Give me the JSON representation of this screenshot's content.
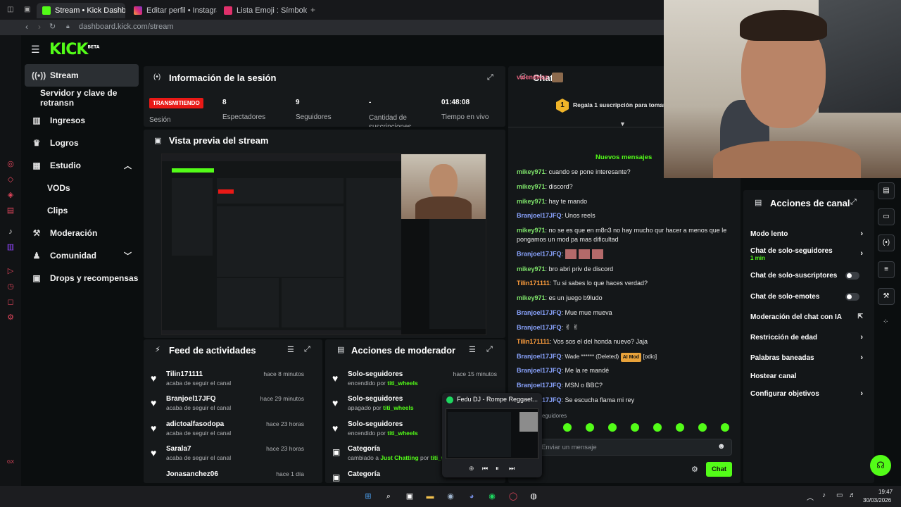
{
  "browser": {
    "tabs": [
      {
        "label": "Stream • Kick Dashboard",
        "active": true
      },
      {
        "label": "Editar perfil • Instagram",
        "active": false
      },
      {
        "label": "Lista Emoji : Símbolos em",
        "active": false
      }
    ],
    "url": "dashboard.kick.com/stream"
  },
  "brand": {
    "logo": "KICK",
    "beta": "BETA"
  },
  "nav": {
    "items": [
      {
        "label": "Stream",
        "icon": "broadcast-icon",
        "active": true
      },
      {
        "label": "Servidor y clave de retransn",
        "icon": "",
        "active": false
      },
      {
        "label": "Ingresos",
        "icon": "bar-chart-icon",
        "active": false
      },
      {
        "label": "Logros",
        "icon": "trophy-icon",
        "active": false
      },
      {
        "label": "Estudio",
        "icon": "grid-icon",
        "active": false
      },
      {
        "label": "VODs",
        "icon": "",
        "active": false
      },
      {
        "label": "Clips",
        "icon": "",
        "active": false
      },
      {
        "label": "Moderación",
        "icon": "wrench-icon",
        "active": false
      },
      {
        "label": "Comunidad",
        "icon": "community-icon",
        "active": false
      },
      {
        "label": "Drops y recompensas",
        "icon": "gift-icon",
        "active": false
      }
    ]
  },
  "session": {
    "title": "Información de la sesión",
    "badge": "TRANSMITIENDO",
    "badge_label": "Sesión",
    "stats": [
      {
        "value": "8",
        "label": "Espectadores"
      },
      {
        "value": "9",
        "label": "Seguidores"
      },
      {
        "value": "-",
        "label": "Cantidad de suscripciones"
      },
      {
        "value": "01:48:08",
        "label": "Tiempo en vivo"
      }
    ]
  },
  "preview": {
    "title": "Vista previa del stream"
  },
  "feed": {
    "title": "Feed de actividades",
    "rows": [
      {
        "name": "Tilin171111",
        "sub": "acaba de seguir el canal",
        "time": "hace 8 minutos"
      },
      {
        "name": "Branjoel17JFQ",
        "sub": "acaba de seguir el canal",
        "time": "hace 29 minutos"
      },
      {
        "name": "adictoalfasodopa",
        "sub": "acaba de seguir el canal",
        "time": "hace 23 horas"
      },
      {
        "name": "Sarala7",
        "sub": "acaba de seguir el canal",
        "time": "hace 23 horas"
      },
      {
        "name": "Jonasanchez06",
        "sub": "",
        "time": "hace 1 día"
      }
    ]
  },
  "modactions": {
    "title": "Acciones de moderador",
    "rows": [
      {
        "name": "Solo-seguidores",
        "sub_a": "encendido por",
        "who": "titi_wheels",
        "time": "hace 15 minutos"
      },
      {
        "name": "Solo-seguidores",
        "sub_a": "apagado por",
        "who": "titi_wheels",
        "time": ""
      },
      {
        "name": "Solo-seguidores",
        "sub_a": "encendido por",
        "who": "titi_wheels",
        "time": ""
      },
      {
        "name": "Categoría",
        "sub_a": "cambiado a",
        "who": "Just Chatting",
        "sub_b": "por",
        "who2": "titi_w",
        "time": ""
      },
      {
        "name": "Categoría",
        "sub_a": "",
        "who": "",
        "time": ""
      }
    ]
  },
  "chat": {
    "title": "Chat",
    "gift": "Regala 1 suscripción para tomar la",
    "new_messages": "Nuevos mensajes",
    "lines": [
      {
        "user": "valendwzz",
        "text": "",
        "color": "#e8637f"
      },
      {
        "user": "mikey971",
        "text": "cuando se pone interesante?",
        "color": "#7ee36a"
      },
      {
        "user": "mikey971",
        "text": "discord?",
        "color": "#7ee36a"
      },
      {
        "user": "mikey971",
        "text": "hay te mando",
        "color": "#7ee36a"
      },
      {
        "user": "Branjoel17JFQ",
        "text": "Unos reels",
        "color": "#8aa4ff"
      },
      {
        "user": "mikey971",
        "text": "no se es que en m8n3 no hay mucho qur hacer a menos que le pongamos un mod pa mas dificultad",
        "color": "#7ee36a"
      },
      {
        "user": "Branjoel17JFQ",
        "text": "",
        "color": "#8aa4ff"
      },
      {
        "user": "mikey971",
        "text": "bro abri priv de discord",
        "color": "#7ee36a"
      },
      {
        "user": "Tilin171111",
        "text": "Tu si sabes lo que haces verdad?",
        "color": "#ff9e3d"
      },
      {
        "user": "mikey971",
        "text": "es un juego b9ludo",
        "color": "#7ee36a"
      },
      {
        "user": "Branjoel17JFQ",
        "text": "Mue mue mueva",
        "color": "#8aa4ff"
      },
      {
        "user": "Branjoel17JFQ",
        "text": "",
        "color": "#8aa4ff"
      },
      {
        "user": "Tilin171111",
        "text": "Vos sos el del honda nuevo? Jaja",
        "color": "#ff9e3d"
      },
      {
        "user": "Branjoel17JFQ",
        "text": "Wade ****** (Deleted)",
        "pill": "AI Mod",
        "extra": "[odio]",
        "color": "#8aa4ff"
      },
      {
        "user": "Branjoel17JFQ",
        "text": "Me la re mandé",
        "color": "#8aa4ff"
      },
      {
        "user": "Branjoel17JFQ",
        "text": "MSN o BBC?",
        "color": "#8aa4ff"
      },
      {
        "user": "Branjoel17JFQ",
        "text": "Se escucha flama mi rey",
        "color": "#8aa4ff"
      }
    ],
    "mode_label": "eguidores",
    "placeholder": "Enviar un mensaje",
    "send_label": "Chat"
  },
  "channel": {
    "title": "Acciones de canal",
    "rows": [
      {
        "label": "Modo lento",
        "control": "chevron"
      },
      {
        "label": "Chat de solo-seguidores",
        "sub": "1 min",
        "control": "chevron"
      },
      {
        "label": "Chat de solo-suscriptores",
        "control": "toggle"
      },
      {
        "label": "Chat de solo-emotes",
        "control": "toggle"
      },
      {
        "label": "Moderación del chat con IA",
        "control": "external"
      },
      {
        "label": "Restricción de edad",
        "control": "chevron"
      },
      {
        "label": "Palabras baneadas",
        "control": "chevron"
      },
      {
        "label": "Hostear canal",
        "control": "none"
      },
      {
        "label": "Configurar objetivos",
        "control": "chevron"
      }
    ]
  },
  "spotify": {
    "track": "Fedu DJ - Rompe Reggaet..."
  },
  "clock": {
    "time": "19:47",
    "date": "30/03/2026"
  },
  "colors": {
    "accent": "#53fc18",
    "live": "#e91916",
    "panel": "#16191b"
  }
}
